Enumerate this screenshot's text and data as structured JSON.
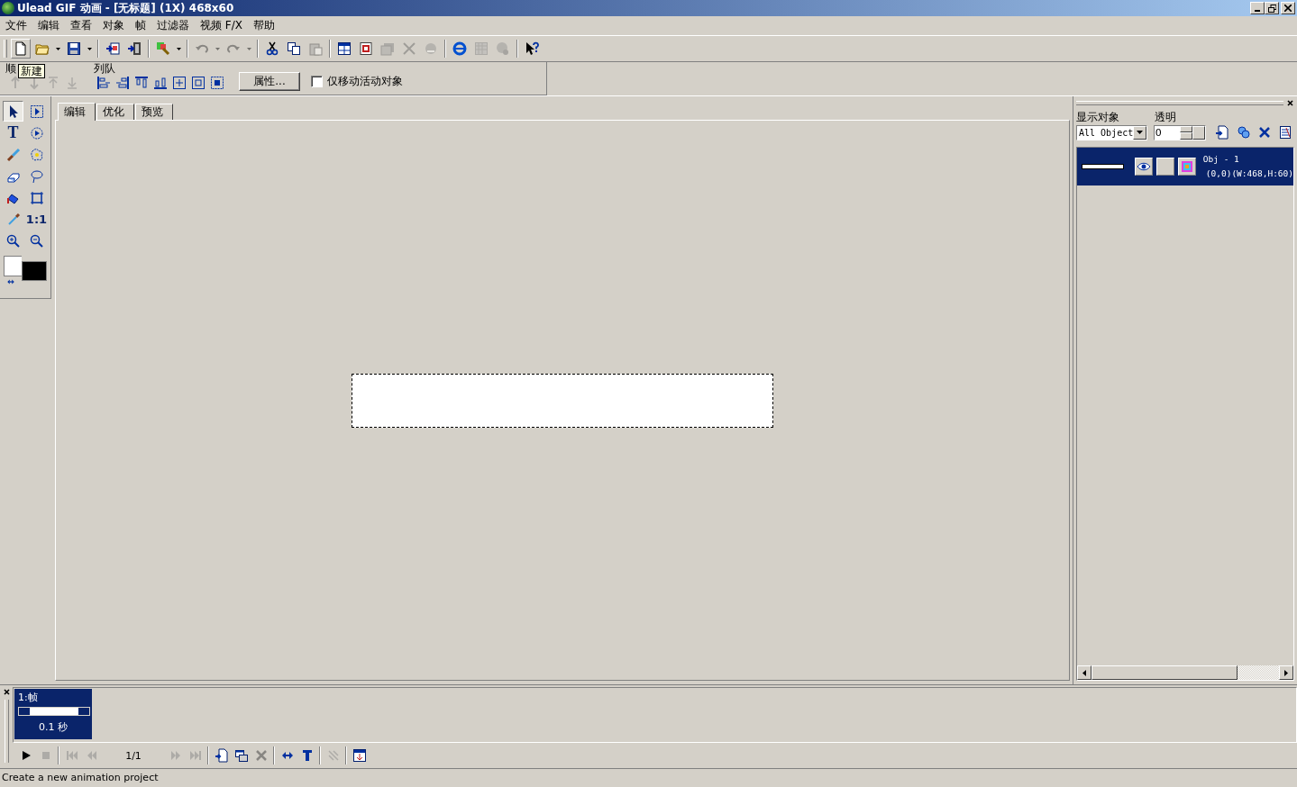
{
  "window": {
    "title": "Ulead GIF 动画 - [无标题] (1X) 468x60"
  },
  "menu": [
    "文件",
    "编辑",
    "查看",
    "对象",
    "帧",
    "过滤器",
    "视频 F/X",
    "帮助"
  ],
  "toolbar": [
    {
      "kind": "button",
      "pressed": true,
      "disabled": false
    },
    {
      "kind": "button",
      "dropdown": true,
      "disabled": false
    },
    {
      "kind": "button",
      "dropdown": true,
      "disabled": false
    },
    {
      "kind": "separator"
    },
    {
      "kind": "button",
      "disabled": false
    },
    {
      "kind": "button",
      "disabled": false
    },
    {
      "kind": "separator"
    },
    {
      "kind": "button",
      "dropdown": true,
      "disabled": false
    },
    {
      "kind": "separator"
    },
    {
      "kind": "button",
      "dropdown": true,
      "disabled": true
    },
    {
      "kind": "button",
      "dropdown": true,
      "disabled": true
    },
    {
      "kind": "separator"
    },
    {
      "kind": "button",
      "disabled": false
    },
    {
      "kind": "button",
      "disabled": false
    },
    {
      "kind": "button",
      "disabled": true
    },
    {
      "kind": "separator"
    },
    {
      "kind": "button",
      "disabled": false
    },
    {
      "kind": "button",
      "disabled": false
    },
    {
      "kind": "button",
      "disabled": true
    },
    {
      "kind": "button",
      "disabled": true
    },
    {
      "kind": "button",
      "disabled": true
    },
    {
      "kind": "separator"
    },
    {
      "kind": "button",
      "disabled": false
    },
    {
      "kind": "button",
      "disabled": true
    },
    {
      "kind": "button",
      "disabled": true
    },
    {
      "kind": "separator"
    },
    {
      "kind": "button",
      "disabled": false
    }
  ],
  "tooltip": "新建",
  "order": {
    "label": "顺",
    "buttons": [
      {
        "disabled": true
      },
      {
        "disabled": true
      },
      {
        "disabled": true
      },
      {
        "disabled": true
      }
    ]
  },
  "align": {
    "label": "列队",
    "buttons": [
      {
        "disabled": false
      },
      {
        "disabled": false
      },
      {
        "disabled": false
      },
      {
        "disabled": false
      },
      {
        "disabled": false
      },
      {
        "disabled": false
      },
      {
        "disabled": false
      }
    ]
  },
  "properties_button": "属性...",
  "move_active_only": {
    "label": "仅移动活动对象",
    "checked": false
  },
  "tools": [
    {
      "selected": true
    },
    {
      "selected": false
    },
    {
      "label": "T",
      "selected": false
    },
    {
      "selected": false
    },
    {
      "selected": false
    },
    {
      "selected": false
    },
    {
      "selected": false
    },
    {
      "selected": false
    },
    {
      "selected": false
    },
    {
      "selected": false
    },
    {
      "selected": false
    },
    {
      "label": "1:1",
      "selected": false
    },
    {
      "selected": false
    },
    {
      "selected": false
    }
  ],
  "tabs": [
    {
      "label": "编辑",
      "selected": true
    },
    {
      "label": "优化",
      "selected": false
    },
    {
      "label": "预览",
      "selected": false
    }
  ],
  "object_panel": {
    "show_label": "显示对象",
    "show_value": "All Object",
    "opacity_label": "透明",
    "opacity_value": "0",
    "objects": [
      {
        "name": "Obj - 1",
        "info": "(0,0)(W:468,H:60)",
        "selected": true,
        "visible": true
      }
    ]
  },
  "frames": [
    {
      "label": "1:帧",
      "delay": "0.1 秒",
      "selected": true
    }
  ],
  "playback": {
    "counter": "1/1"
  },
  "status_bar": "Create a new animation project"
}
